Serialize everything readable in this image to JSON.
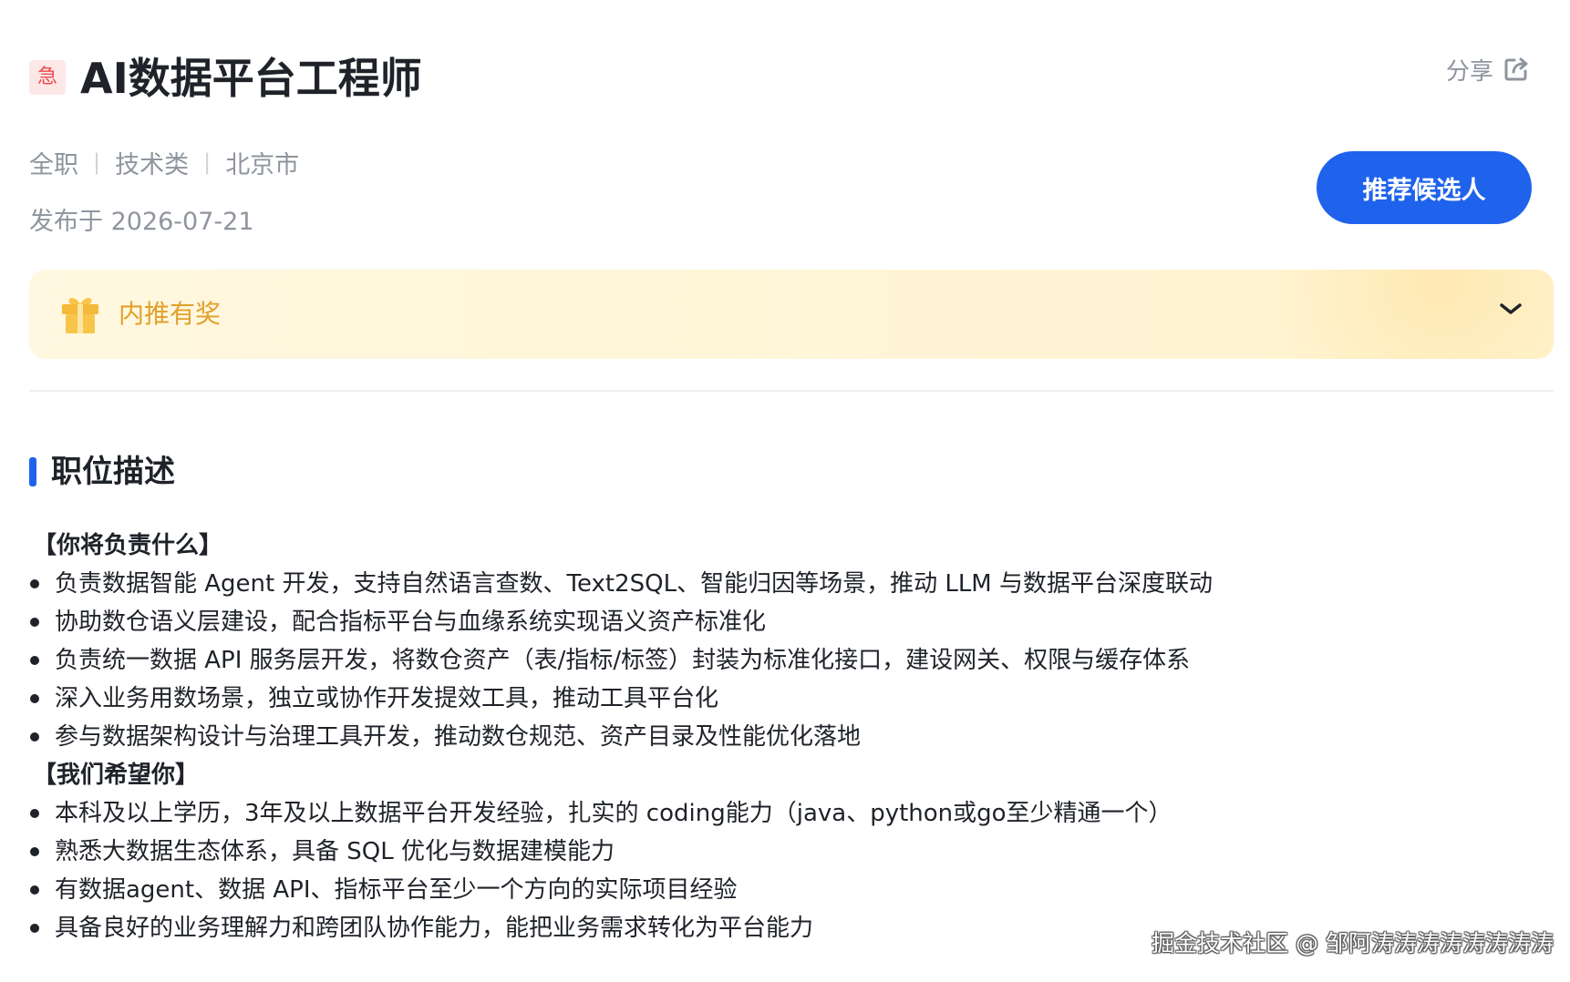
{
  "job": {
    "urgent_tag": "急",
    "title": "AI数据平台工程师",
    "share_label": "分享",
    "meta": [
      "全职",
      "技术类",
      "北京市"
    ],
    "publish_date": "发布于 2026-07-21",
    "recommend_button": "推荐候选人"
  },
  "reward": {
    "label": "内推有奖"
  },
  "description": {
    "section_title": "职位描述",
    "responsibilities_heading": "【你将负责什么】",
    "responsibilities": [
      "负责数据智能 Agent 开发，支持自然语言查数、Text2SQL、智能归因等场景，推动 LLM 与数据平台深度联动",
      "协助数仓语义层建设，配合指标平台与血缘系统实现语义资产标准化",
      "负责统一数据 API 服务层开发，将数仓资产（表/指标/标签）封装为标准化接口，建设网关、权限与缓存体系",
      "深入业务用数场景，独立或协作开发提效工具，推动工具平台化",
      "参与数据架构设计与治理工具开发，推动数仓规范、资产目录及性能优化落地"
    ],
    "requirements_heading": "【我们希望你】",
    "requirements": [
      "本科及以上学历，3年及以上数据平台开发经验，扎实的 coding能力（java、python或go至少精通一个）",
      "熟悉大数据生态体系，具备 SQL 优化与数据建模能力",
      "有数据agent、数据 API、指标平台至少一个方向的实际项目经验",
      "具备良好的业务理解力和跨团队协作能力，能把业务需求转化为平台能力"
    ]
  },
  "watermark": "掘金技术社区 @ 邹阿涛涛涛涛涛涛涛涛",
  "colors": {
    "primary": "#1f63ec",
    "urgent": "#ef4a4a",
    "reward_text": "#e1a12b",
    "reward_bg": "#fff5d6",
    "muted_text": "#8f959e"
  },
  "icons": [
    "share-icon",
    "gift-icon",
    "chevron-down-icon"
  ]
}
